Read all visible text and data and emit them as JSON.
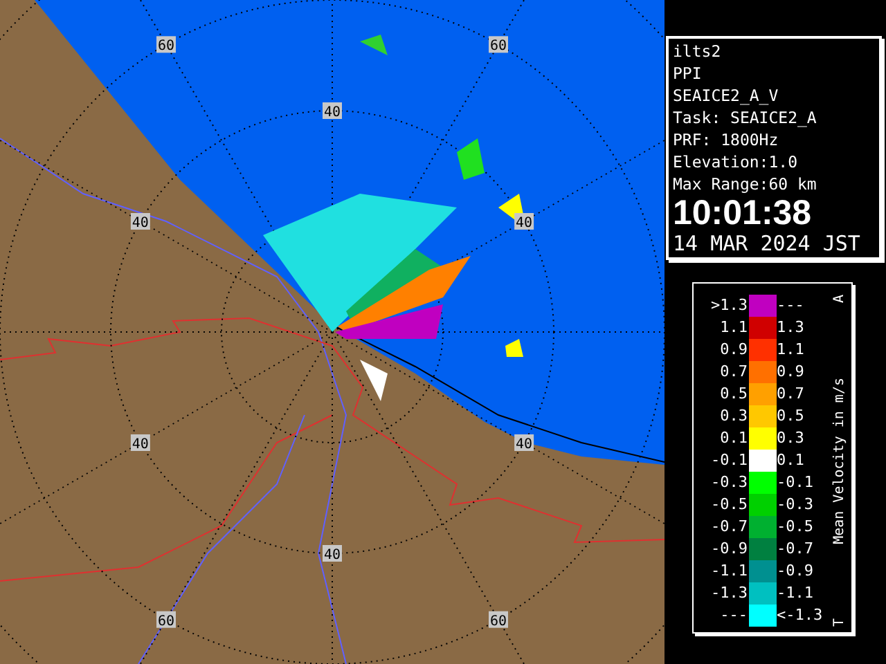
{
  "map": {
    "range_labels": [
      "60",
      "60",
      "40",
      "40",
      "40",
      "40",
      "40",
      "40",
      "60",
      "60"
    ]
  },
  "info": {
    "lines": [
      "ilts2",
      "PPI",
      "SEAICE2_A_V",
      "Task: SEAICE2_A",
      "PRF: 1800Hz",
      "Elevation:1.0",
      "Max Range:60 km"
    ],
    "time": "10:01:38",
    "date": "14 MAR 2024 JST"
  },
  "legend": {
    "title": "Mean Velocity in m/s",
    "marker_top": "A",
    "marker_bottom": "T",
    "rows": [
      {
        "low": ">1.3",
        "high": "---",
        "color": "#c000c0"
      },
      {
        "low": "1.1",
        "high": "1.3",
        "color": "#d00000"
      },
      {
        "low": "0.9",
        "high": "1.1",
        "color": "#ff3000"
      },
      {
        "low": "0.7",
        "high": "0.9",
        "color": "#ff7000"
      },
      {
        "low": "0.5",
        "high": "0.7",
        "color": "#ffa000"
      },
      {
        "low": "0.3",
        "high": "0.5",
        "color": "#ffc800"
      },
      {
        "low": "0.1",
        "high": "0.3",
        "color": "#ffff00"
      },
      {
        "low": "-0.1",
        "high": "0.1",
        "color": "#ffffff"
      },
      {
        "low": "-0.3",
        "high": "-0.1",
        "color": "#00ff00"
      },
      {
        "low": "-0.5",
        "high": "-0.3",
        "color": "#00d000"
      },
      {
        "low": "-0.7",
        "high": "-0.5",
        "color": "#00b030"
      },
      {
        "low": "-0.9",
        "high": "-0.7",
        "color": "#008040"
      },
      {
        "low": "-1.1",
        "high": "-0.9",
        "color": "#009090"
      },
      {
        "low": "-1.3",
        "high": "-1.1",
        "color": "#00c0c0"
      },
      {
        "low": "---",
        "high": "<-1.3",
        "color": "#00ffff"
      }
    ]
  }
}
